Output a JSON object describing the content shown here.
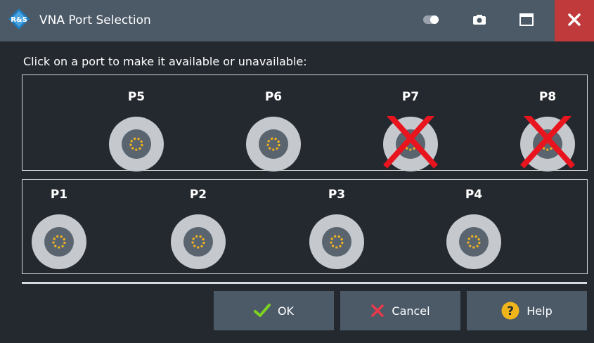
{
  "window": {
    "title": "VNA Port Selection"
  },
  "instruction": "Click on a port to make it available or unavailable:",
  "ports_top": [
    {
      "label": "P5",
      "available": true
    },
    {
      "label": "P6",
      "available": true
    },
    {
      "label": "P7",
      "available": false
    },
    {
      "label": "P8",
      "available": false
    }
  ],
  "ports_bottom": [
    {
      "label": "P1",
      "available": true
    },
    {
      "label": "P2",
      "available": true
    },
    {
      "label": "P3",
      "available": true
    },
    {
      "label": "P4",
      "available": true
    }
  ],
  "buttons": {
    "ok": "OK",
    "cancel": "Cancel",
    "help": "Help"
  },
  "icons": {
    "logo": "rs-logo-icon",
    "toggle": "toggle-icon",
    "camera": "camera-icon",
    "maximize": "maximize-icon",
    "close": "close-icon",
    "ok": "checkmark-icon",
    "cancel": "cross-icon",
    "help": "question-mark-icon",
    "unavailable": "red-x-icon"
  },
  "colors": {
    "background": "#24292f",
    "titlebar": "#4c5967",
    "close_button": "#c0393b",
    "port_ring": "#c5c9ce",
    "port_center": "#5a646f",
    "port_dots": "#f1b51c",
    "unavailable_mark": "#e8141e",
    "ok_check": "#7ed321",
    "cancel_cross": "#e8394a",
    "help_circle": "#f1b51c"
  }
}
